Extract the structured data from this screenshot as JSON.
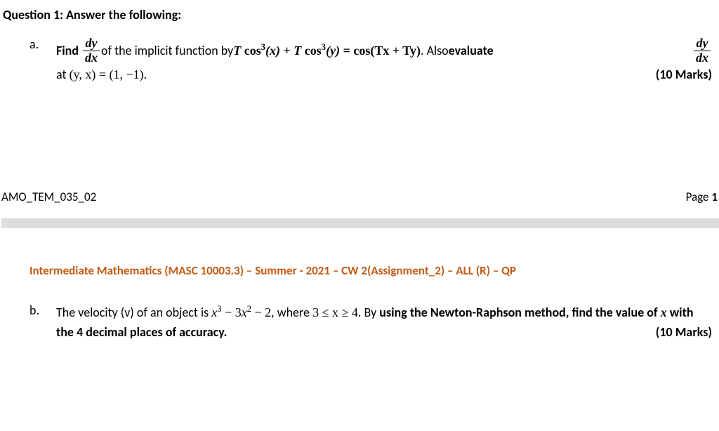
{
  "question_header": "Question 1: Answer the following:",
  "part_a": {
    "label": "a.",
    "find_word": "Find",
    "frac_num": "dy",
    "frac_den": "dx",
    "text1": " of the implicit function by ",
    "equation_lhs_T1": "T ",
    "equation_cos": "cos",
    "equation_exp": "3",
    "equation_x": "(x)",
    "equation_plus": " + ",
    "equation_T2": "T ",
    "equation_y": "(y)",
    "equation_eq": " = ",
    "equation_rhs_cos": "cos",
    "equation_rhs_inner": "(Tx + Ty)",
    "text2": ". Also ",
    "evaluate_word": "evaluate",
    "line2_at": "at ",
    "line2_point": " (y, x) = (1, −1).",
    "marks": "(10 Marks)"
  },
  "footer": {
    "code": "AMO_TEM_035_02",
    "page_label": "Page ",
    "page_num": "1"
  },
  "header_colored": "Intermediate Mathematics (MASC 10003.3) – Summer - 2021 – CW 2(Assignment_2) – ALL (R) – QP",
  "part_b": {
    "label": "b.",
    "text1": "The velocity (v) of an object is ",
    "eq_x3": "x",
    "eq_exp3": "3",
    "eq_minus1": " − ",
    "eq_3x2": "3x",
    "eq_exp2": "2",
    "eq_minus2": " − 2",
    "text2": ", where ",
    "range": "3 ≤ x ≥ 4",
    "text3": ".  By ",
    "bold1": "using the Newton-Raphson method, find the value of ",
    "var_x": "x",
    "bold2": " with the 4 decimal places of accuracy.",
    "marks": "(10 Marks)"
  }
}
